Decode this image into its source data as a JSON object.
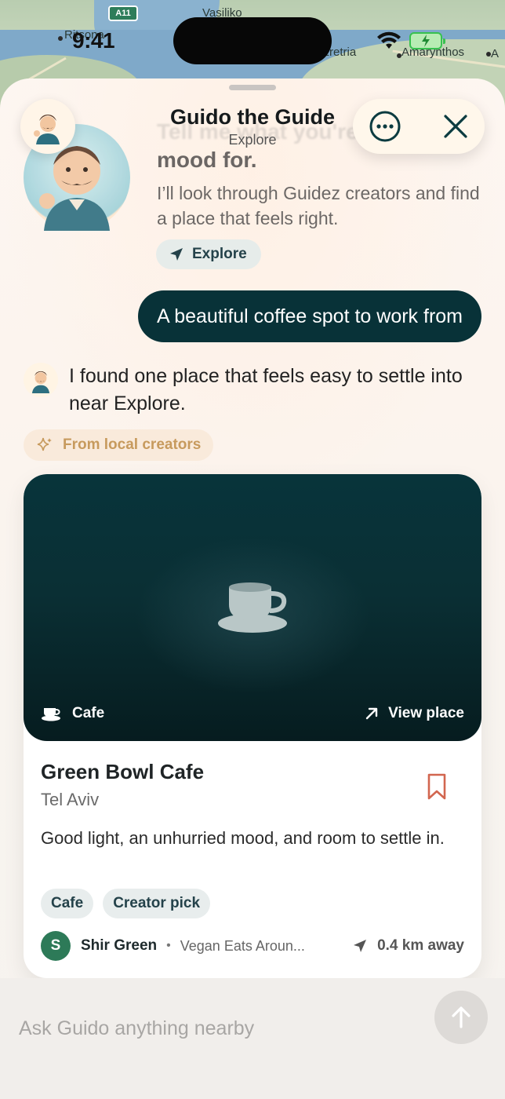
{
  "status_bar": {
    "time": "9:41"
  },
  "map": {
    "labels": {
      "vasiliko": "Vasiliko",
      "eretria": "Eretria",
      "amarynthos": "Amarynthos",
      "ritsona": "Ritsona",
      "edge": "A"
    },
    "road_shield": "A11"
  },
  "header": {
    "title": "Guido the Guide",
    "subtitle": "Explore",
    "avatar_icon": "guide-avatar",
    "more_icon": "ellipsis-circle-icon",
    "close_icon": "close-icon"
  },
  "intro": {
    "faded_line": "Tell me what you're in the",
    "title": "mood for.",
    "text": "I’ll look through Guidez creators and find a place that feels right.",
    "chip_label": "Explore"
  },
  "conversation": {
    "user_message": "A beautiful coffee spot to work from",
    "guide_reply": "I found one place that feels easy to settle into near Explore.",
    "source_chip": "From local creators"
  },
  "place_card": {
    "category": "Cafe",
    "view_label": "View place",
    "name": "Green Bowl Cafe",
    "city": "Tel Aviv",
    "description": "Good light, an unhurried mood, and room to settle in.",
    "tags": [
      "Cafe",
      "Creator pick"
    ],
    "creator": {
      "initial": "S",
      "name": "Shir Green",
      "list": "Vegan Eats Aroun..."
    },
    "distance": "0.4 km away",
    "accent_color": "#083238",
    "bookmark_color": "#d2664f"
  },
  "composer": {
    "placeholder": "Ask Guido anything nearby",
    "send_icon": "arrow-up-icon"
  }
}
